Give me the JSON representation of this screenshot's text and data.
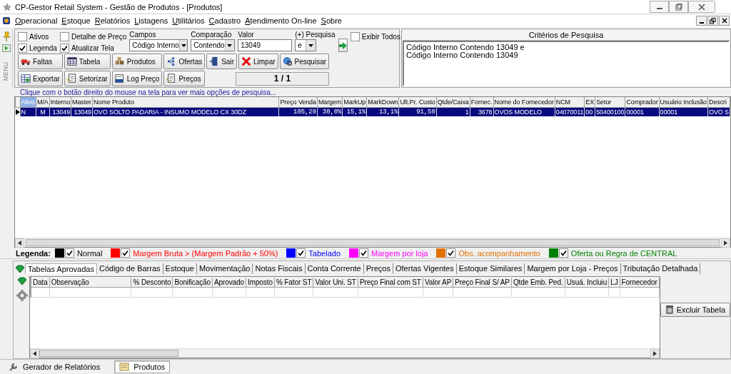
{
  "window": {
    "title": "CP-Gestor Retail System - Gestão de Produtos - [Produtos]"
  },
  "menu": [
    "Operacional",
    "Estoque",
    "Relatórios",
    "Listagens",
    "Utilitários",
    "Cadastro",
    "Atendimento On-line",
    "Sobre"
  ],
  "side_tab": "MENU",
  "filters": {
    "checkboxes": [
      {
        "label": "Ativos",
        "checked": false
      },
      {
        "label": "Detalhe de Preço",
        "checked": false
      },
      {
        "label": "Legenda",
        "checked": true
      },
      {
        "label": "Atualizar Tela",
        "checked": true
      }
    ],
    "fields": [
      {
        "label": "Campos",
        "value": "Código Interno",
        "kind": "select"
      },
      {
        "label": "Comparação",
        "value": "Contendo",
        "kind": "select"
      },
      {
        "label": "Valor",
        "value": "13049",
        "kind": "input"
      },
      {
        "label": "(+) Pesquisa",
        "value": "e",
        "kind": "select"
      }
    ],
    "show_all": {
      "label": "Exibir Todos",
      "checked": false
    },
    "buttons": [
      [
        "Faltas",
        "Tabela",
        "Produtos",
        "Ofertas",
        "Sair",
        "Limpar",
        "Pesquisar"
      ],
      [
        "Exportar",
        "Setorizar",
        "Log Preço",
        "Preços"
      ]
    ],
    "page": "1 / 1"
  },
  "criteria": {
    "title": "Critérios de Pesquisa",
    "lines": [
      "Código Interno Contendo 13049 e",
      "Código Interno Contendo 13049"
    ]
  },
  "hint": "Clique com o botão direito do mouse na tela para ver mais opções de pesquisa...",
  "products": {
    "columns": [
      {
        "label": "Ativo",
        "highlighted": true
      },
      {
        "label": "M/A",
        "highlighted": false
      },
      {
        "label": "Interno",
        "highlighted": false
      },
      {
        "label": "Master",
        "highlighted": false
      },
      {
        "label": "Nome Produto",
        "highlighted": false
      },
      {
        "label": "Preço Venda",
        "highlighted": false
      },
      {
        "label": "Margem",
        "highlighted": false
      },
      {
        "label": "MarkUp",
        "highlighted": false
      },
      {
        "label": "MarkDown",
        "highlighted": false
      },
      {
        "label": "Ult.Pr. Custo",
        "highlighted": false
      },
      {
        "label": "Qtde/Caixa",
        "highlighted": false
      },
      {
        "label": "Fornec.",
        "highlighted": false
      },
      {
        "label": "Nome do Fornecedor",
        "highlighted": false
      },
      {
        "label": "NCM",
        "highlighted": false
      },
      {
        "label": "EX",
        "highlighted": false
      },
      {
        "label": "Setor",
        "highlighted": false
      },
      {
        "label": "Comprador",
        "highlighted": false
      },
      {
        "label": "Usuário Inclusão",
        "highlighted": false
      },
      {
        "label": "Descri",
        "highlighted": false
      }
    ],
    "rows": [
      {
        "selected": true,
        "cells": [
          "N",
          "M",
          "13049",
          "13049",
          "OVO SOLTO PADARIA - INSUMO MODELO CX 30DZ",
          "105,29",
          "30,0%",
          "15,1%",
          "13,1%",
          "91,50",
          "1",
          "3678",
          "OVOS MODELO",
          "04070011",
          "00",
          "50400100",
          "00001",
          "00001",
          "OVO S"
        ]
      }
    ]
  },
  "legend": {
    "label": "Legenda:",
    "items": [
      {
        "label": "Normal",
        "color": "#000000",
        "checked": true
      },
      {
        "label": "Margem Bruta > (Margem Padrão + 50%)",
        "color": "#ff0000",
        "checked": true
      },
      {
        "label": "Tabelado",
        "color": "#0000ff",
        "checked": true
      },
      {
        "label": "Margem por loja",
        "color": "#ff00ff",
        "checked": true
      },
      {
        "label": "Obs. acompanhamento",
        "color": "#e07000",
        "checked": true
      },
      {
        "label": "Oferta ou Regra de CENTRAL",
        "color": "#008000",
        "checked": true
      }
    ]
  },
  "detail_tabs": [
    {
      "label": "Tabelas Aprovadas",
      "selected": true
    },
    {
      "label": "Código de Barras",
      "selected": false
    },
    {
      "label": "Estoque",
      "selected": false
    },
    {
      "label": "Movimentação",
      "selected": false
    },
    {
      "label": "Notas Fiscais",
      "selected": false
    },
    {
      "label": "Conta Corrente",
      "selected": false
    },
    {
      "label": "Preços",
      "selected": false
    },
    {
      "label": "Ofertas Vigentes",
      "selected": false
    },
    {
      "label": "Estoque Similares",
      "selected": false
    },
    {
      "label": "Margem por Loja - Preços",
      "selected": false
    },
    {
      "label": "Tributação Detalhada",
      "selected": false
    }
  ],
  "detail_table": {
    "columns": [
      {
        "label": "Data"
      },
      {
        "label": "Observação"
      },
      {
        "label": "% Desconto"
      },
      {
        "label": "Bonificação"
      },
      {
        "label": "Aprovado"
      },
      {
        "label": "Imposto"
      },
      {
        "label": "% Fator ST"
      },
      {
        "label": "Valor Uni. ST"
      },
      {
        "label": "Preço Final com ST"
      },
      {
        "label": "Valor AP"
      },
      {
        "label": "Preço Final S/ AP"
      },
      {
        "label": "Qtde Emb. Ped."
      },
      {
        "label": "Usuá. Incluiu"
      },
      {
        "label": "LJ"
      },
      {
        "label": "Fornecedor"
      }
    ]
  },
  "actions": [
    "Excluir Tabela"
  ],
  "taskbar": [
    {
      "label": "Gerador de Relatórios",
      "selected": false
    },
    {
      "label": "Produtos",
      "selected": true
    }
  ]
}
